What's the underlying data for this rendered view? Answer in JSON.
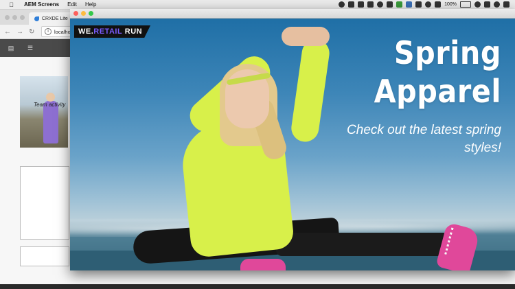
{
  "menubar": {
    "app_name": "AEM Screens",
    "menus": [
      "Edit",
      "Help"
    ],
    "battery": "100%"
  },
  "browser": {
    "tab_title": "CRXDE Lite",
    "url_text": "localhost",
    "thumbnail_caption": "Team activity"
  },
  "app_window": {
    "logo": {
      "part1": "WE.",
      "part2": "RETAIL",
      "part3": " RUN"
    },
    "headline_line1": "Spring",
    "headline_line2": "Apparel",
    "subheadline": "Check out the latest spring styles!",
    "colors": {
      "accent": "#7b5cff",
      "jacket": "#d8f04a",
      "shoe": "#e0489a"
    }
  }
}
